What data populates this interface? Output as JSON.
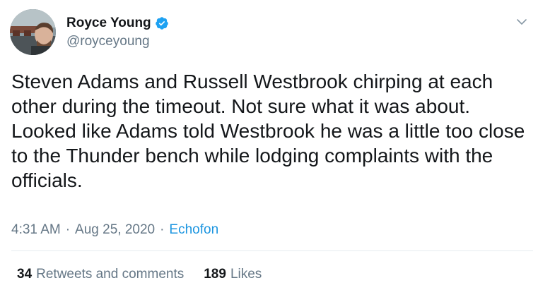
{
  "author": {
    "display_name": "Royce Young",
    "handle": "@royceyoung",
    "verified": true,
    "verified_color": "#1da1f2"
  },
  "tweet": {
    "text": "Steven Adams and Russell Westbrook chirping at each other during the timeout. Not sure what it was about. Looked like Adams told Westbrook he was a little too close to the Thunder bench while lodging complaints with the officials.",
    "time": "4:31 AM",
    "separator": "·",
    "date": "Aug 25, 2020",
    "source": "Echofon"
  },
  "stats": {
    "retweets_count": "34",
    "retweets_label": "Retweets and comments",
    "likes_count": "189",
    "likes_label": "Likes"
  },
  "colors": {
    "text": "#14171a",
    "secondary": "#657786",
    "link": "#1b95e0",
    "divider": "#e6ecf0"
  },
  "icons": {
    "verified": "verified-badge-icon",
    "menu": "chevron-down-icon"
  }
}
